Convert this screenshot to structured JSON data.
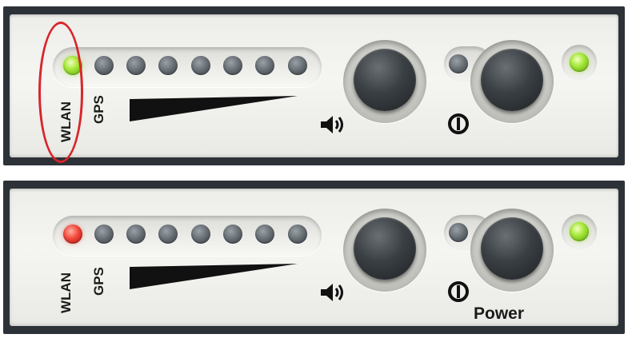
{
  "panels": [
    {
      "id": "top",
      "wlan_label": "WLAN",
      "gps_label": "GPS",
      "wlan_led_color": "green",
      "led_bar_count": 7,
      "highlight_color": "#d8262b",
      "status_led_color": "green"
    },
    {
      "id": "bottom",
      "wlan_label": "WLAN",
      "gps_label": "GPS",
      "wlan_led_color": "red",
      "led_bar_count": 7,
      "power_caption": "Power",
      "status_led_color": "green"
    }
  ],
  "icons": {
    "volume": "speaker-volume-icon",
    "power": "power-icon"
  },
  "colors": {
    "led_green": "#a6e83a",
    "led_red": "#f0463a",
    "led_off": "#5f666b",
    "highlight": "#d8262b"
  }
}
